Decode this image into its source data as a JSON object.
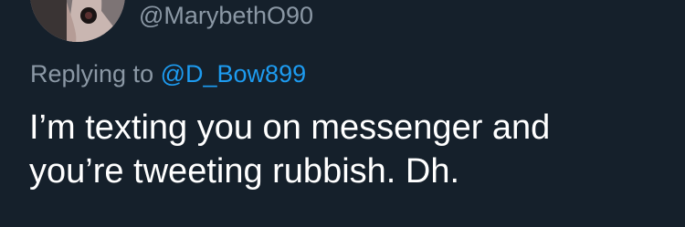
{
  "tweet": {
    "author": {
      "handle": "@MarybethO90",
      "avatar_icon": "profile-photo"
    },
    "reply_context": {
      "prefix": "Replying to",
      "mention": "@D_Bow899"
    },
    "text_lines": [
      "I’m texting you on messenger and",
      "you’re tweeting rubbish. Dh."
    ]
  },
  "colors": {
    "background": "#15202b",
    "secondary_text": "#8b98a5",
    "mention": "#1d9bf0",
    "primary_text": "#ffffff"
  }
}
